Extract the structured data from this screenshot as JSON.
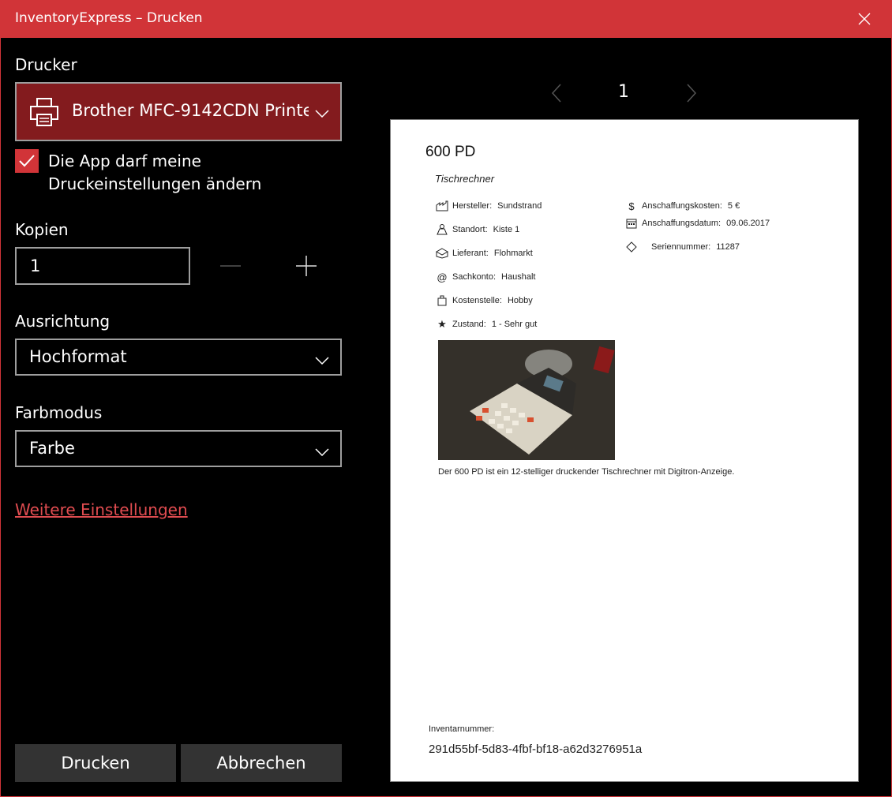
{
  "window": {
    "title": "InventoryExpress – Drucken"
  },
  "printer": {
    "label": "Drucker",
    "selected": "Brother MFC-9142CDN Printe",
    "allow_app_settings": {
      "checked": true,
      "label": "Die App darf meine Druckeinstellungen ändern"
    }
  },
  "copies": {
    "label": "Kopien",
    "value": "1"
  },
  "orientation": {
    "label": "Ausrichtung",
    "selected": "Hochformat"
  },
  "color_mode": {
    "label": "Farbmodus",
    "selected": "Farbe"
  },
  "more_settings_link": "Weitere Einstellungen",
  "buttons": {
    "print": "Drucken",
    "cancel": "Abbrechen"
  },
  "pager": {
    "current_page": "1"
  },
  "preview": {
    "title": "600 PD",
    "subtitle": "Tischrechner",
    "left_props": [
      {
        "icon": "factory-icon",
        "label": "Hersteller:",
        "value": "Sundstrand"
      },
      {
        "icon": "person-icon",
        "label": "Standort:",
        "value": "Kiste 1"
      },
      {
        "icon": "delivery-icon",
        "label": "Lieferant:",
        "value": "Flohmarkt"
      },
      {
        "icon": "at-icon",
        "label": "Sachkonto:",
        "value": "Haushalt"
      },
      {
        "icon": "bag-icon",
        "label": "Kostenstelle:",
        "value": "Hobby"
      },
      {
        "icon": "star-icon",
        "label": "Zustand:",
        "value": "1 - Sehr gut"
      }
    ],
    "right_props": [
      {
        "icon": "dollar-icon",
        "label": "Anschaffungskosten:",
        "value": "5  €"
      },
      {
        "icon": "calendar-icon",
        "label": "Anschaffungsdatum:",
        "value": "09.06.2017"
      },
      {
        "icon": "diamond-icon",
        "label": "Seriennummer:",
        "value": "11287"
      }
    ],
    "description": "Der 600 PD ist ein 12-stelliger druckender Tischrechner mit Digitron-Anzeige.",
    "inventory_label": "Inventarnummer:",
    "inventory_number": "291d55bf-5d83-4fbf-bf18-a62d3276951a"
  },
  "colors": {
    "accent": "#d13438",
    "printer_bg": "#831b1e",
    "link": "#e04c50",
    "button_bg": "#333333"
  }
}
